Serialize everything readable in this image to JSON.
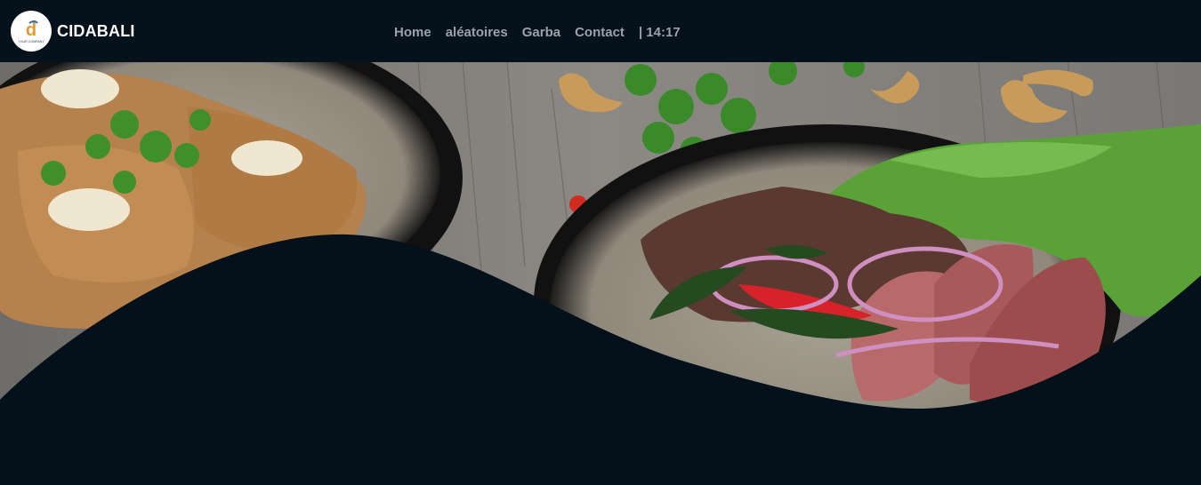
{
  "brand": {
    "name": "CIDABALI",
    "logo_letter": "d",
    "logo_text": "YOUR COMPANY",
    "logo_icon": "company-logo-icon"
  },
  "nav": {
    "items": [
      {
        "label": "Home"
      },
      {
        "label": "aléatoires"
      },
      {
        "label": "Garba"
      },
      {
        "label": "Contact"
      }
    ],
    "clock": "| 14:17"
  },
  "hero": {
    "image": "food-plates-photo",
    "wave_color": "#04111a"
  },
  "colors": {
    "navbar_bg": "#05121b",
    "nav_text": "#9aa3ab",
    "brand_text": "#ffffff"
  }
}
